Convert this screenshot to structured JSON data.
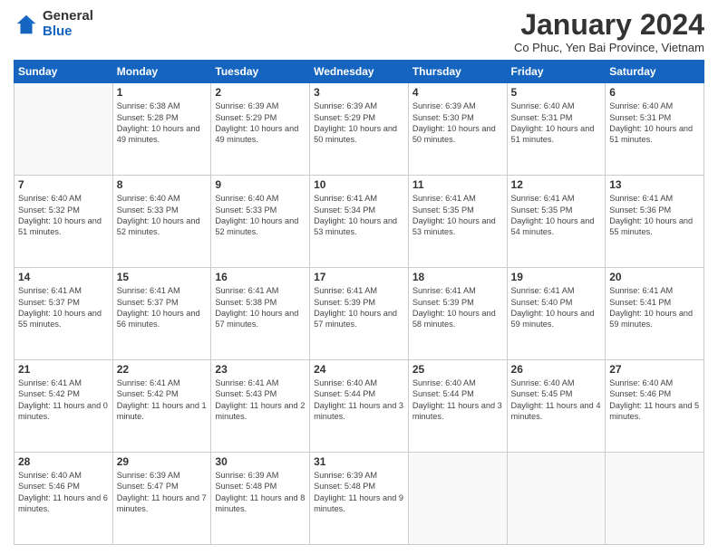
{
  "header": {
    "logo_general": "General",
    "logo_blue": "Blue",
    "month": "January 2024",
    "location": "Co Phuc, Yen Bai Province, Vietnam"
  },
  "days_of_week": [
    "Sunday",
    "Monday",
    "Tuesday",
    "Wednesday",
    "Thursday",
    "Friday",
    "Saturday"
  ],
  "weeks": [
    [
      {
        "day": "",
        "empty": true,
        "sunrise": "",
        "sunset": "",
        "daylight": ""
      },
      {
        "day": "1",
        "empty": false,
        "sunrise": "6:38 AM",
        "sunset": "5:28 PM",
        "daylight": "10 hours and 49 minutes."
      },
      {
        "day": "2",
        "empty": false,
        "sunrise": "6:39 AM",
        "sunset": "5:29 PM",
        "daylight": "10 hours and 49 minutes."
      },
      {
        "day": "3",
        "empty": false,
        "sunrise": "6:39 AM",
        "sunset": "5:29 PM",
        "daylight": "10 hours and 50 minutes."
      },
      {
        "day": "4",
        "empty": false,
        "sunrise": "6:39 AM",
        "sunset": "5:30 PM",
        "daylight": "10 hours and 50 minutes."
      },
      {
        "day": "5",
        "empty": false,
        "sunrise": "6:40 AM",
        "sunset": "5:31 PM",
        "daylight": "10 hours and 51 minutes."
      },
      {
        "day": "6",
        "empty": false,
        "sunrise": "6:40 AM",
        "sunset": "5:31 PM",
        "daylight": "10 hours and 51 minutes."
      }
    ],
    [
      {
        "day": "7",
        "empty": false,
        "sunrise": "6:40 AM",
        "sunset": "5:32 PM",
        "daylight": "10 hours and 51 minutes."
      },
      {
        "day": "8",
        "empty": false,
        "sunrise": "6:40 AM",
        "sunset": "5:33 PM",
        "daylight": "10 hours and 52 minutes."
      },
      {
        "day": "9",
        "empty": false,
        "sunrise": "6:40 AM",
        "sunset": "5:33 PM",
        "daylight": "10 hours and 52 minutes."
      },
      {
        "day": "10",
        "empty": false,
        "sunrise": "6:41 AM",
        "sunset": "5:34 PM",
        "daylight": "10 hours and 53 minutes."
      },
      {
        "day": "11",
        "empty": false,
        "sunrise": "6:41 AM",
        "sunset": "5:35 PM",
        "daylight": "10 hours and 53 minutes."
      },
      {
        "day": "12",
        "empty": false,
        "sunrise": "6:41 AM",
        "sunset": "5:35 PM",
        "daylight": "10 hours and 54 minutes."
      },
      {
        "day": "13",
        "empty": false,
        "sunrise": "6:41 AM",
        "sunset": "5:36 PM",
        "daylight": "10 hours and 55 minutes."
      }
    ],
    [
      {
        "day": "14",
        "empty": false,
        "sunrise": "6:41 AM",
        "sunset": "5:37 PM",
        "daylight": "10 hours and 55 minutes."
      },
      {
        "day": "15",
        "empty": false,
        "sunrise": "6:41 AM",
        "sunset": "5:37 PM",
        "daylight": "10 hours and 56 minutes."
      },
      {
        "day": "16",
        "empty": false,
        "sunrise": "6:41 AM",
        "sunset": "5:38 PM",
        "daylight": "10 hours and 57 minutes."
      },
      {
        "day": "17",
        "empty": false,
        "sunrise": "6:41 AM",
        "sunset": "5:39 PM",
        "daylight": "10 hours and 57 minutes."
      },
      {
        "day": "18",
        "empty": false,
        "sunrise": "6:41 AM",
        "sunset": "5:39 PM",
        "daylight": "10 hours and 58 minutes."
      },
      {
        "day": "19",
        "empty": false,
        "sunrise": "6:41 AM",
        "sunset": "5:40 PM",
        "daylight": "10 hours and 59 minutes."
      },
      {
        "day": "20",
        "empty": false,
        "sunrise": "6:41 AM",
        "sunset": "5:41 PM",
        "daylight": "10 hours and 59 minutes."
      }
    ],
    [
      {
        "day": "21",
        "empty": false,
        "sunrise": "6:41 AM",
        "sunset": "5:42 PM",
        "daylight": "11 hours and 0 minutes."
      },
      {
        "day": "22",
        "empty": false,
        "sunrise": "6:41 AM",
        "sunset": "5:42 PM",
        "daylight": "11 hours and 1 minute."
      },
      {
        "day": "23",
        "empty": false,
        "sunrise": "6:41 AM",
        "sunset": "5:43 PM",
        "daylight": "11 hours and 2 minutes."
      },
      {
        "day": "24",
        "empty": false,
        "sunrise": "6:40 AM",
        "sunset": "5:44 PM",
        "daylight": "11 hours and 3 minutes."
      },
      {
        "day": "25",
        "empty": false,
        "sunrise": "6:40 AM",
        "sunset": "5:44 PM",
        "daylight": "11 hours and 3 minutes."
      },
      {
        "day": "26",
        "empty": false,
        "sunrise": "6:40 AM",
        "sunset": "5:45 PM",
        "daylight": "11 hours and 4 minutes."
      },
      {
        "day": "27",
        "empty": false,
        "sunrise": "6:40 AM",
        "sunset": "5:46 PM",
        "daylight": "11 hours and 5 minutes."
      }
    ],
    [
      {
        "day": "28",
        "empty": false,
        "sunrise": "6:40 AM",
        "sunset": "5:46 PM",
        "daylight": "11 hours and 6 minutes."
      },
      {
        "day": "29",
        "empty": false,
        "sunrise": "6:39 AM",
        "sunset": "5:47 PM",
        "daylight": "11 hours and 7 minutes."
      },
      {
        "day": "30",
        "empty": false,
        "sunrise": "6:39 AM",
        "sunset": "5:48 PM",
        "daylight": "11 hours and 8 minutes."
      },
      {
        "day": "31",
        "empty": false,
        "sunrise": "6:39 AM",
        "sunset": "5:48 PM",
        "daylight": "11 hours and 9 minutes."
      },
      {
        "day": "",
        "empty": true,
        "sunrise": "",
        "sunset": "",
        "daylight": ""
      },
      {
        "day": "",
        "empty": true,
        "sunrise": "",
        "sunset": "",
        "daylight": ""
      },
      {
        "day": "",
        "empty": true,
        "sunrise": "",
        "sunset": "",
        "daylight": ""
      }
    ]
  ]
}
